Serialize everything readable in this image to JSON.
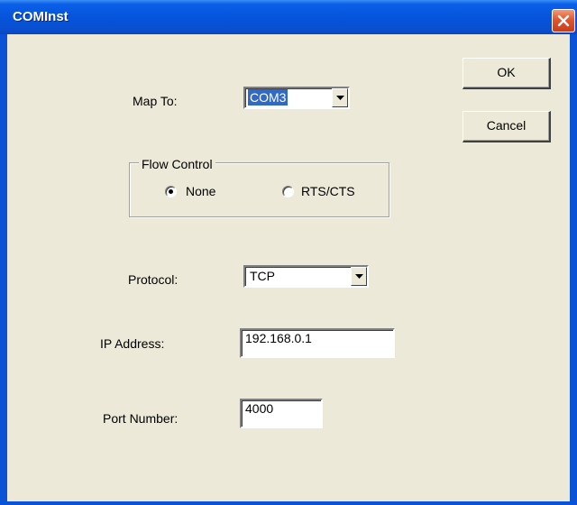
{
  "window": {
    "title": "COMInst",
    "colors": {
      "titlebar": "#0553d9",
      "client": "#ece9d8",
      "close": "#e0552e",
      "selection": "#316ac5"
    }
  },
  "buttons": {
    "ok": "OK",
    "cancel": "Cancel"
  },
  "map_to": {
    "label": "Map To:",
    "value": "COM3"
  },
  "flow_control": {
    "label": "Flow Control",
    "options": [
      {
        "label": "None",
        "checked": true
      },
      {
        "label": "RTS/CTS",
        "checked": false
      }
    ]
  },
  "protocol": {
    "label": "Protocol:",
    "value": "TCP"
  },
  "ip_address": {
    "label": "IP Address:",
    "value": "192.168.0.1"
  },
  "port_number": {
    "label": "Port Number:",
    "value": "4000"
  },
  "icons": {
    "close": "close-icon",
    "dropdown": "chevron-down-icon",
    "radio": "radio-button"
  }
}
